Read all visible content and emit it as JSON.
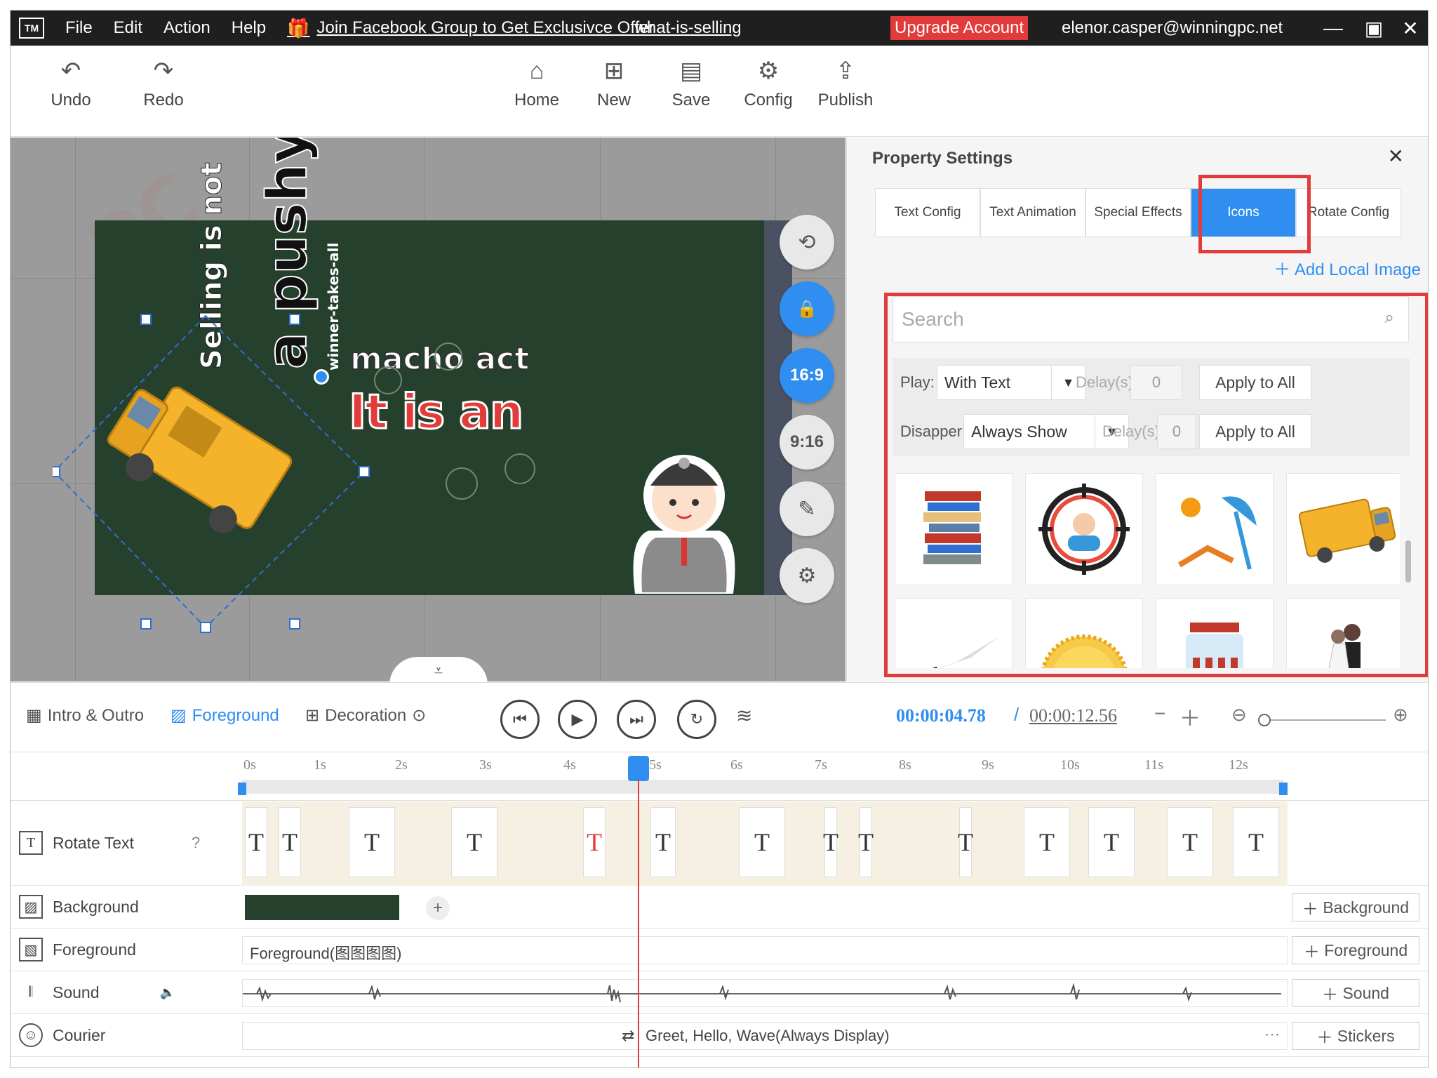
{
  "titlebar": {
    "logo": "TM",
    "menu": [
      "File",
      "Edit",
      "Action",
      "Help"
    ],
    "promo": "Join Facebook Group to Get Exclusivce Offer",
    "doc_name": "what-is-selling",
    "upgrade": "Upgrade Account",
    "email": "elenor.casper@winningpc.net"
  },
  "toolbar": {
    "undo": "Undo",
    "redo": "Redo",
    "home": "Home",
    "new": "New",
    "save": "Save",
    "config": "Config",
    "publish": "Publish"
  },
  "canvas": {
    "text_selling": "Selling is not",
    "text_pushy": "a pushy",
    "text_winner": "winner-takes-all",
    "text_macho": "macho act",
    "text_itis": "It is an",
    "ratio_169": "16:9",
    "ratio_916": "9:16"
  },
  "props": {
    "title": "Property Settings",
    "tabs": [
      "Text Config",
      "Text Animation",
      "Special Effects",
      "Icons",
      "Rotate Config"
    ],
    "active_tab": "Icons",
    "add_local": "Add Local Image",
    "search_placeholder": "Search",
    "play_label": "Play:",
    "play_value": "With Text",
    "disappear_label": "Disapper:",
    "disappear_value": "Always Show",
    "delay_label": "Delay(s)",
    "delay_value": "0",
    "apply_all": "Apply to All",
    "icons": [
      "books-icon",
      "target-person-icon",
      "beach-icon",
      "delivery-truck-icon",
      "knife-icon",
      "sun-icon",
      "jar-icon",
      "wedding-couple-icon"
    ]
  },
  "controls": {
    "tabs": [
      "Intro & Outro",
      "Foreground",
      "Decoration"
    ],
    "active_tab": "Foreground",
    "current_time": "00:00:04.78",
    "total_time": "00:00:12.56",
    "sep": "/"
  },
  "ruler": {
    "ticks": [
      "0s",
      "1s",
      "2s",
      "3s",
      "4s",
      "5s",
      "6s",
      "7s",
      "8s",
      "9s",
      "10s",
      "11s",
      "12s"
    ]
  },
  "tracks": {
    "rotate_text": "Rotate Text",
    "background": "Background",
    "foreground": "Foreground",
    "foreground_clip": "Foreground(图图图图)",
    "sound": "Sound",
    "courier": "Courier",
    "courier_clip": "Greet, Hello, Wave(Always Display)",
    "add_background": "Background",
    "add_foreground": "Foreground",
    "add_sound": "Sound",
    "add_stickers": "Stickers"
  },
  "colors": {
    "accent": "#2f8ef0",
    "alert": "#e23b3b",
    "board": "#25402d"
  }
}
